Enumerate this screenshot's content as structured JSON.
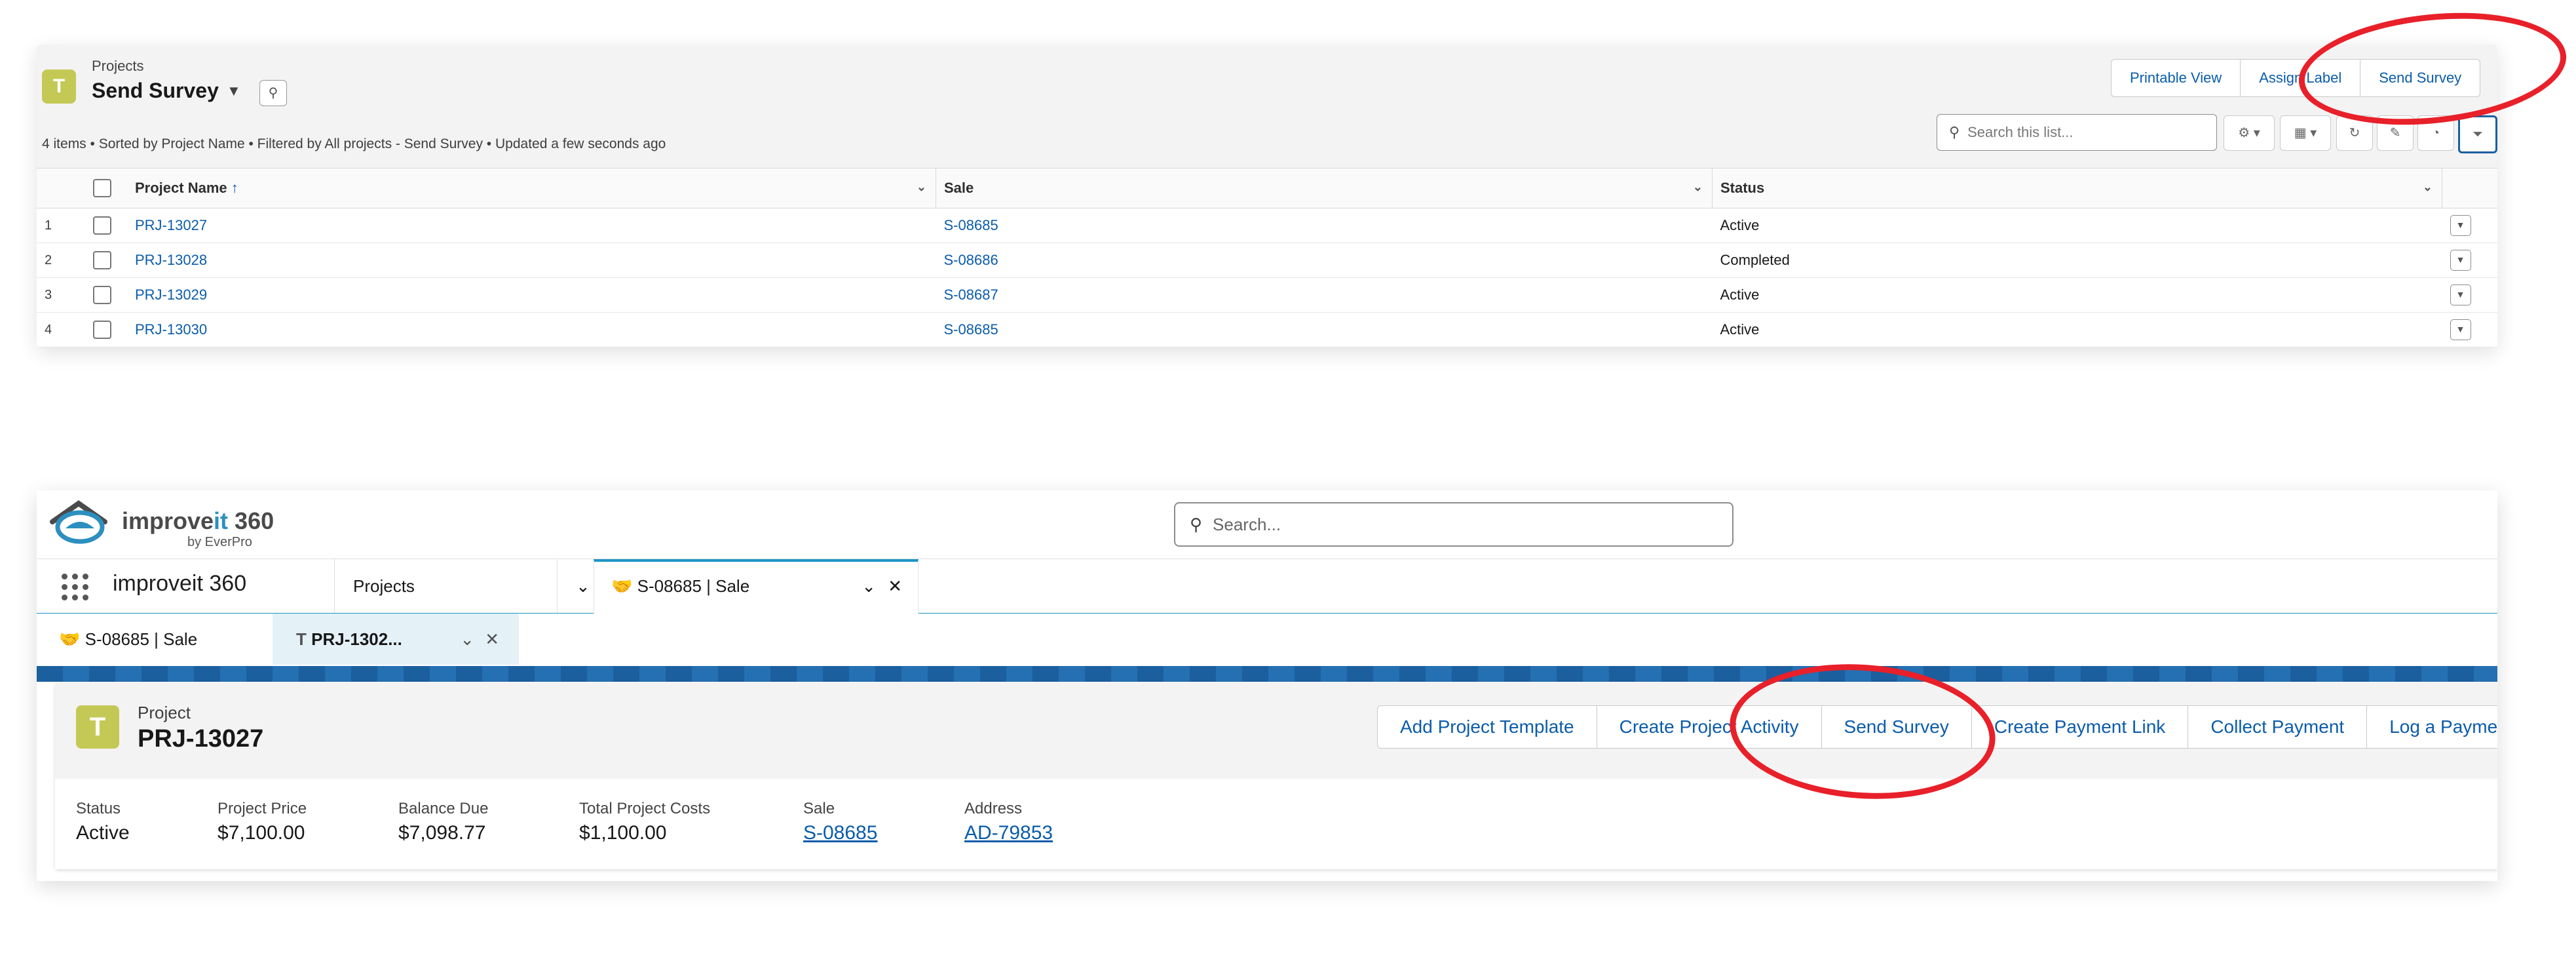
{
  "list_view": {
    "object_label": "Projects",
    "view_name": "Send Survey",
    "status_line": "4 items • Sorted by Project Name • Filtered by All projects - Send Survey • Updated a few seconds ago",
    "actions": [
      "Printable View",
      "Assign Label",
      "Send Survey"
    ],
    "search_placeholder": "Search this list...",
    "columns": [
      "Project Name",
      "Sale",
      "Status"
    ],
    "sort_indicator": "↑",
    "rows": [
      {
        "num": "1",
        "project": "PRJ-13027",
        "sale": "S-08685",
        "status": "Active"
      },
      {
        "num": "2",
        "project": "PRJ-13028",
        "sale": "S-08686",
        "status": "Completed"
      },
      {
        "num": "3",
        "project": "PRJ-13029",
        "sale": "S-08687",
        "status": "Active"
      },
      {
        "num": "4",
        "project": "PRJ-13030",
        "sale": "S-08685",
        "status": "Active"
      }
    ]
  },
  "app": {
    "brand_main": "improve",
    "brand_it": "it",
    "brand_num": " 360",
    "brand_sub": "by EverPro",
    "search_placeholder": "Search...",
    "app_name": "improveit 360",
    "nav_items": [
      {
        "label": "Projects"
      },
      {
        "label": "S-08685 | Sale"
      }
    ],
    "subtabs": [
      {
        "label": "S-08685 | Sale"
      },
      {
        "label": "PRJ-1302..."
      }
    ]
  },
  "record": {
    "object_label": "Project",
    "title": "PRJ-13027",
    "actions": [
      "Add Project Template",
      "Create Project Activity",
      "Send Survey",
      "Create Payment Link",
      "Collect Payment",
      "Log a Payment"
    ],
    "fields": [
      {
        "label": "Status",
        "value": "Active"
      },
      {
        "label": "Project Price",
        "value": "$7,100.00"
      },
      {
        "label": "Balance Due",
        "value": "$7,098.77"
      },
      {
        "label": "Total Project Costs",
        "value": "$1,100.00"
      },
      {
        "label": "Sale",
        "value": "S-08685"
      },
      {
        "label": "Address",
        "value": "AD-79853"
      }
    ]
  },
  "colors": {
    "object_icon": "#c4c955",
    "link": "#0b5cab",
    "annotation": "#e8202a",
    "brand_accent": "#1b96c8"
  },
  "icons": {
    "object": "T",
    "pin": "pin-icon",
    "search": "search-icon"
  }
}
